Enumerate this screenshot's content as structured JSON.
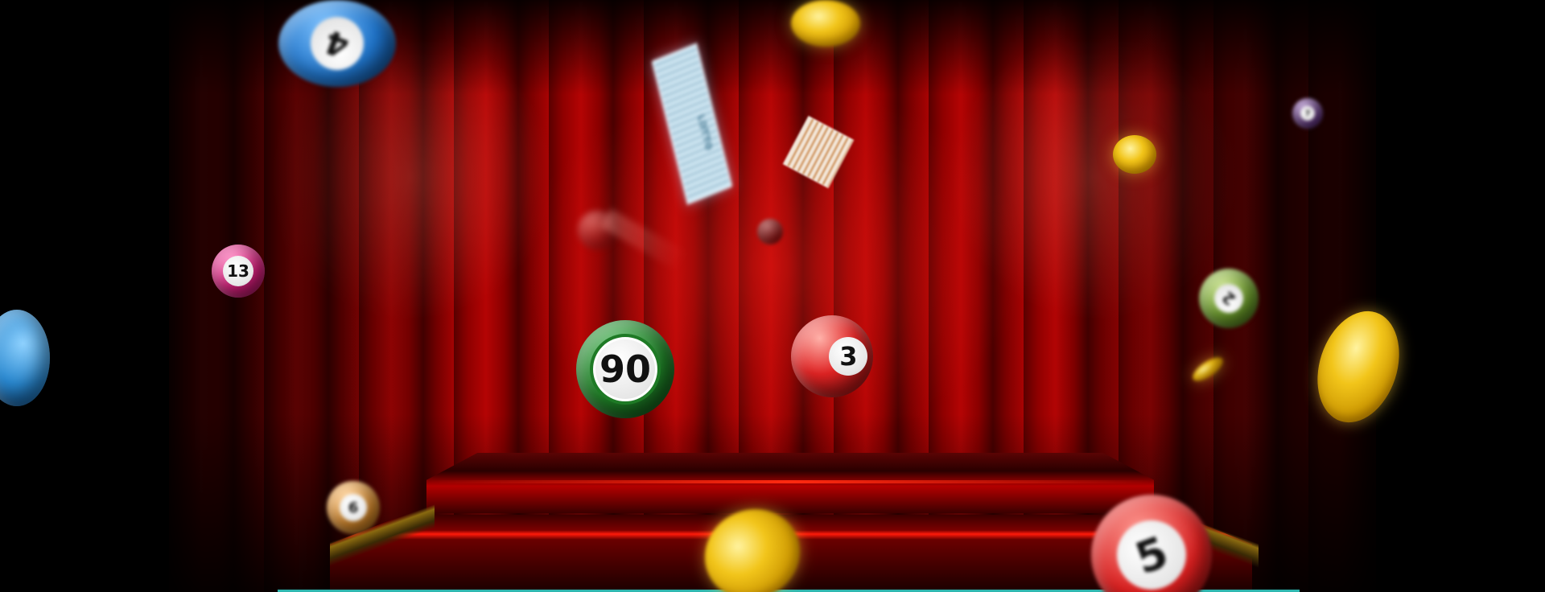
{
  "balls": [
    {
      "label": "4",
      "color": "#1f73c8"
    },
    {
      "label": "13",
      "color": "#d81e7c"
    },
    {
      "label": "90",
      "color": "#1e7a25"
    },
    {
      "label": "3",
      "color": "#d81f1f"
    },
    {
      "label": "5",
      "color": "#d81f1f"
    },
    {
      "label": "2",
      "color": "#6a9a2a"
    },
    {
      "label": "6",
      "color": "#d2862a"
    },
    {
      "label": "7",
      "color": "#6a3a8a"
    }
  ],
  "tickets": [
    {
      "label": "LOTTO"
    }
  ],
  "colors": {
    "curtain": "#a80303",
    "stage_glow": "#ff1a0a",
    "gold": "#f2c51a",
    "bottom_line": "#2fb7b0"
  }
}
